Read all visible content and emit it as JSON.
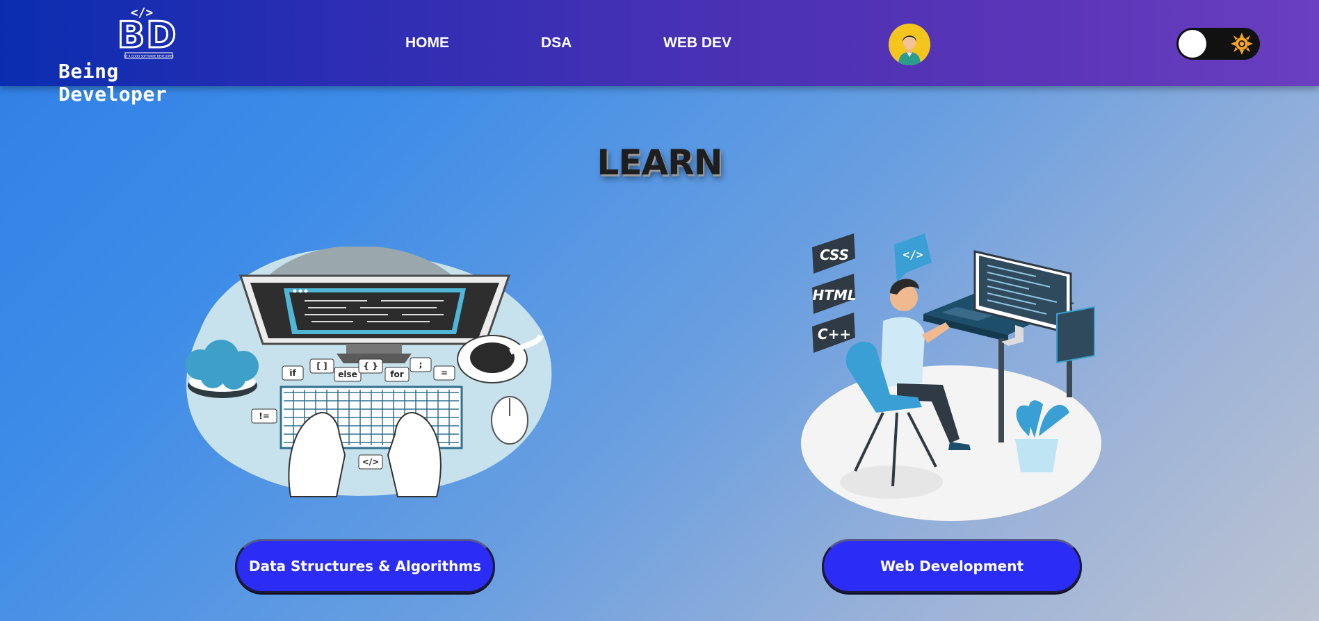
{
  "header": {
    "brand": {
      "name": "Being Developer",
      "logo_text": "BD",
      "logo_code_glyph": "</>",
      "logo_tagline": "BE A GOOD SOFTWARE DEVELOPER"
    },
    "nav": [
      {
        "label": "HOME"
      },
      {
        "label": "DSA"
      },
      {
        "label": "WEB DEV"
      }
    ],
    "avatar": {
      "icon": "user-avatar-icon",
      "bg": "#f4c61d"
    },
    "theme_toggle": {
      "state": "light",
      "icon": "sun-icon"
    }
  },
  "main": {
    "title": "LEARN",
    "cards": [
      {
        "illustration": "keyboard-coding-illustration",
        "button_label": "Data Structures & Algorithms",
        "bubbles": [
          "if",
          "[ ]",
          "else",
          "{ }",
          "for",
          ";",
          "=",
          "!=",
          "</>"
        ]
      },
      {
        "illustration": "web-developer-desk-illustration",
        "button_label": "Web Development",
        "tags": [
          "CSS",
          "HTML",
          "C++",
          "</>"
        ]
      }
    ]
  },
  "colors": {
    "navbar_start": "#0a2db0",
    "navbar_end": "#6a3fc0",
    "button_bg": "#2b2cf5",
    "sun": "#f5a623"
  }
}
